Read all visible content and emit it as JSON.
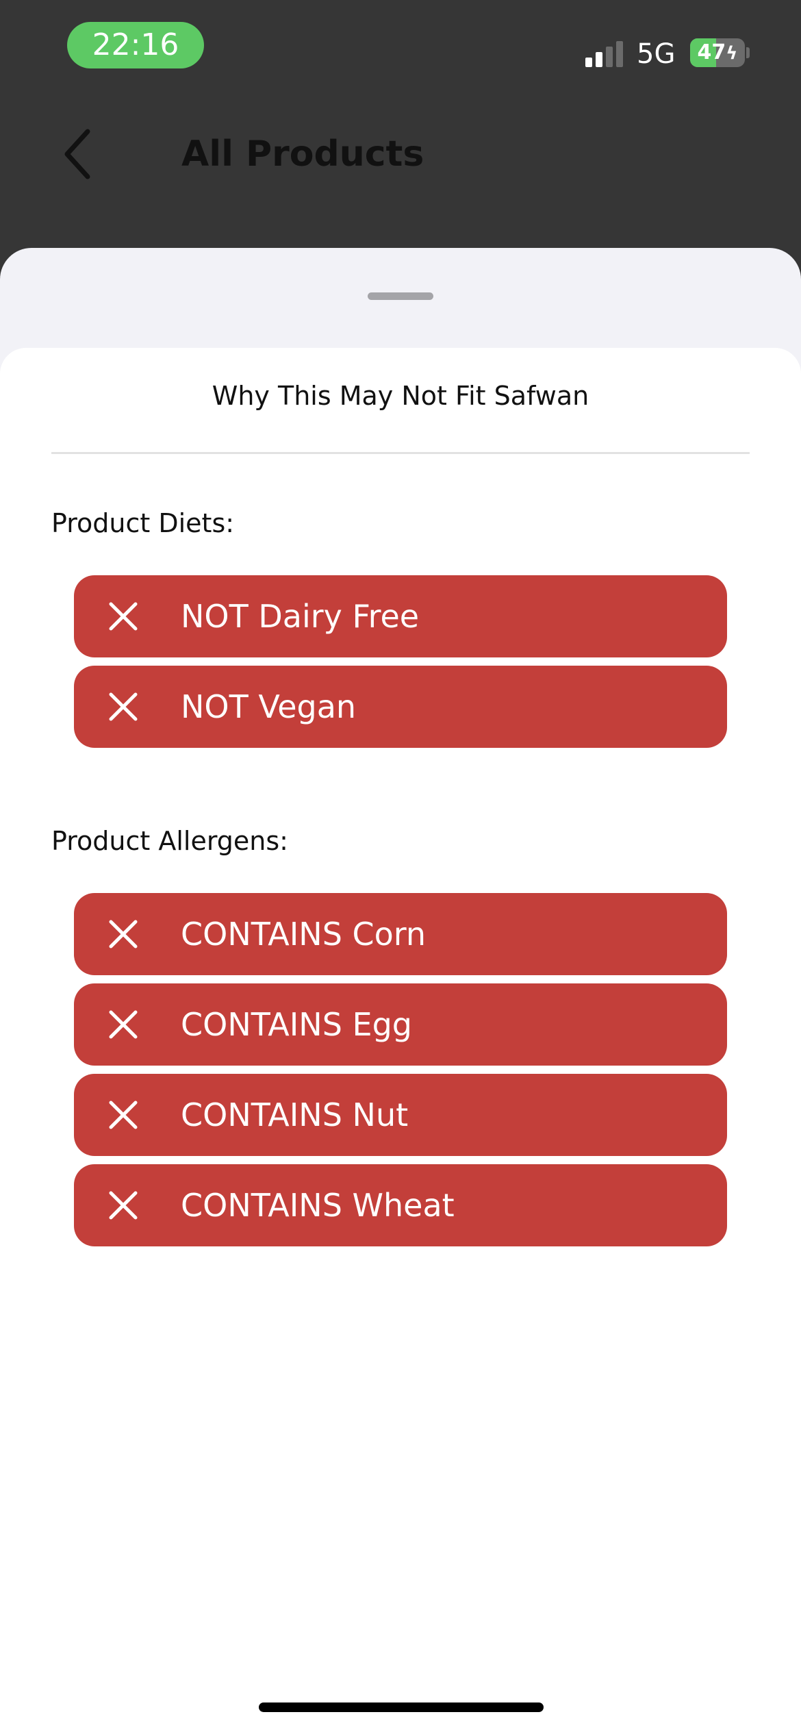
{
  "status_bar": {
    "time": "22:16",
    "network": "5G",
    "battery_level": "47",
    "battery_fraction": 0.47,
    "signal_bars_active": 2,
    "signal_bars_total": 4,
    "colors": {
      "pill": "#5dc964",
      "battery_fill": "#5dc964"
    }
  },
  "nav": {
    "back_icon": "chevron-left-icon",
    "title": "All Products"
  },
  "sheet": {
    "title": "Why This May Not Fit Safwan",
    "diets": {
      "heading": "Product Diets:",
      "items": [
        {
          "label": "NOT Dairy Free",
          "icon": "close-icon"
        },
        {
          "label": "NOT Vegan",
          "icon": "close-icon"
        }
      ]
    },
    "allergens": {
      "heading": "Product Allergens:",
      "items": [
        {
          "label": "CONTAINS Corn",
          "icon": "close-icon"
        },
        {
          "label": "CONTAINS Egg",
          "icon": "close-icon"
        },
        {
          "label": "CONTAINS Nut",
          "icon": "close-icon"
        },
        {
          "label": "CONTAINS Wheat",
          "icon": "close-icon"
        }
      ]
    },
    "colors": {
      "tag_background": "#c33f3a",
      "tag_text": "#ffffff"
    }
  }
}
